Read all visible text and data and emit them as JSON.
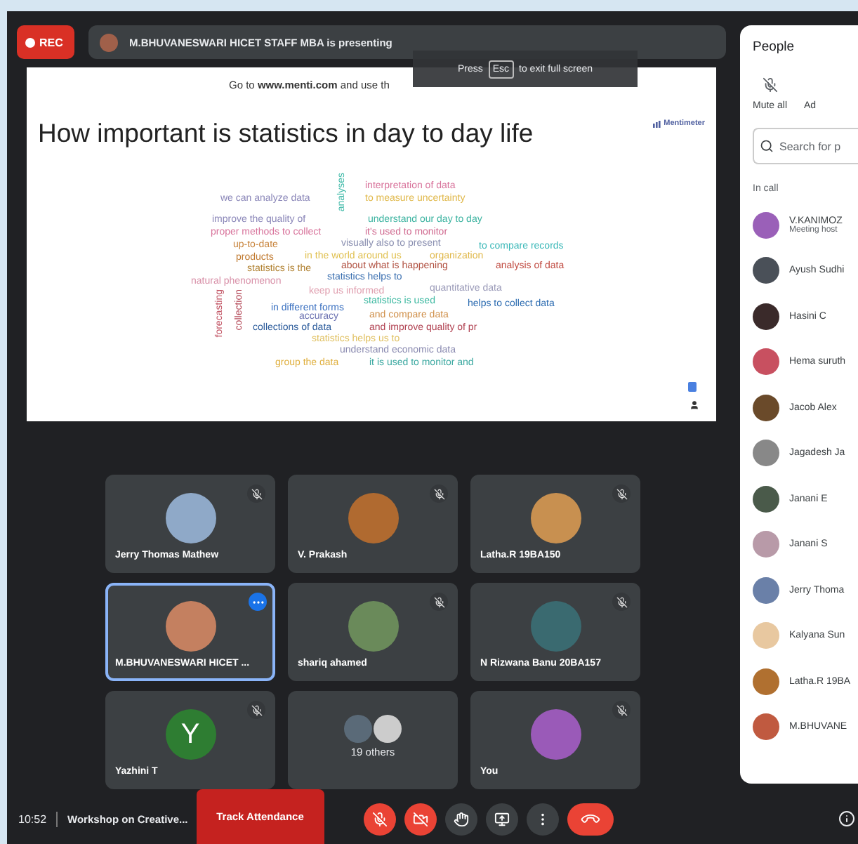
{
  "top_bar": {
    "rec_label": "REC",
    "presenting": "M.BHUVANESWARI HICET STAFF MBA is presenting"
  },
  "fullscreen_hint": {
    "before": "Press",
    "key": "Esc",
    "after": "to exit full screen"
  },
  "slide": {
    "instruction": "Go to **www.menti.com** and use th",
    "title": "How important is statistics in day to day life",
    "brand": "Mentimeter",
    "word_cloud": [
      {
        "text": "we can analyze data",
        "color": "#8a86b8"
      },
      {
        "text": "analyses",
        "color": "#3bb8a6"
      },
      {
        "text": "interpretation of data",
        "color": "#d8739b"
      },
      {
        "text": "to measure uncertainty",
        "color": "#e0b84a"
      },
      {
        "text": "improve the quality of",
        "color": "#8a86b8"
      },
      {
        "text": "understand our day to day",
        "color": "#3bb3a0"
      },
      {
        "text": "proper methods to collect",
        "color": "#d8739b"
      },
      {
        "text": "it's used to monitor",
        "color": "#d06a90"
      },
      {
        "text": "up-to-date",
        "color": "#c8843c"
      },
      {
        "text": "visually also to present",
        "color": "#8a8fb0"
      },
      {
        "text": "to compare records",
        "color": "#3bb8b8"
      },
      {
        "text": "products",
        "color": "#c07a30"
      },
      {
        "text": "in the world around us",
        "color": "#e0c050"
      },
      {
        "text": "organization",
        "color": "#e0b84a"
      },
      {
        "text": "statistics is the",
        "color": "#b08030"
      },
      {
        "text": "about what is happening",
        "color": "#b05040"
      },
      {
        "text": "analysis of data",
        "color": "#c04a40"
      },
      {
        "text": "natural phenomenon",
        "color": "#d890a8"
      },
      {
        "text": "statistics helps to",
        "color": "#3a6fb0"
      },
      {
        "text": "keep us informed",
        "color": "#e0a0b0"
      },
      {
        "text": "quantitative data",
        "color": "#9a9ab8"
      },
      {
        "text": "forecasting",
        "color": "#c05060"
      },
      {
        "text": "collection",
        "color": "#b04050"
      },
      {
        "text": "in different forms",
        "color": "#3a70c0"
      },
      {
        "text": "statistics is used",
        "color": "#3bb8a0"
      },
      {
        "text": "helps to collect data",
        "color": "#2a6ab0"
      },
      {
        "text": "accuracy",
        "color": "#6a70b0"
      },
      {
        "text": "and compare data",
        "color": "#d0904a"
      },
      {
        "text": "collections of data",
        "color": "#2a5a9a"
      },
      {
        "text": "and improve quality of pr",
        "color": "#b04050"
      },
      {
        "text": "statistics helps us to",
        "color": "#e0c060"
      },
      {
        "text": "understand economic data",
        "color": "#8a8ab0"
      },
      {
        "text": "group the data",
        "color": "#e0b040"
      },
      {
        "text": "it is used to monitor and",
        "color": "#3aa8a0"
      }
    ]
  },
  "tiles": [
    {
      "name": "Jerry Thomas Mathew",
      "muted": true,
      "selected": false,
      "avatar": {
        "kind": "photo"
      }
    },
    {
      "name": "V. Prakash",
      "muted": true,
      "selected": false,
      "avatar": {
        "kind": "photo"
      }
    },
    {
      "name": "Latha.R 19BA150",
      "muted": true,
      "selected": false,
      "avatar": {
        "kind": "photo"
      }
    },
    {
      "name": "M.BHUVANESWARI HICET ...",
      "muted": false,
      "selected": true,
      "avatar": {
        "kind": "photo"
      }
    },
    {
      "name": "shariq ahamed",
      "muted": true,
      "selected": false,
      "avatar": {
        "kind": "photo"
      }
    },
    {
      "name": "N Rizwana Banu 20BA157",
      "muted": true,
      "selected": false,
      "avatar": {
        "kind": "photo"
      }
    },
    {
      "name": "Yazhini T",
      "muted": true,
      "selected": false,
      "avatar": {
        "kind": "letter",
        "letter": "Y",
        "color": "#2e7d32"
      }
    },
    {
      "name": "19 others",
      "muted": false,
      "selected": false,
      "avatar": {
        "kind": "group"
      }
    },
    {
      "name": "You",
      "muted": true,
      "selected": false,
      "avatar": {
        "kind": "photo"
      }
    }
  ],
  "people_panel": {
    "title": "People",
    "actions": [
      "Mute all",
      "Ad"
    ],
    "search": {
      "placeholder": "Search for p"
    },
    "section": "In call",
    "people": [
      {
        "name": "V.KANIMOZ",
        "subtitle": "Meeting host"
      },
      {
        "name": "Ayush Sudhi"
      },
      {
        "name": "Hasini C"
      },
      {
        "name": "Hema suruth"
      },
      {
        "name": "Jacob Alex"
      },
      {
        "name": "Jagadesh Ja"
      },
      {
        "name": "Janani E"
      },
      {
        "name": "Janani S"
      },
      {
        "name": "Jerry Thoma"
      },
      {
        "name": "Kalyana Sun"
      },
      {
        "name": "Latha.R 19BA"
      },
      {
        "name": "M.BHUVANE"
      }
    ]
  },
  "bottom_bar": {
    "time": "10:52",
    "meeting_title": "Workshop on Creative...",
    "track_button": "Track Attendance",
    "controls": [
      {
        "kind": "mic",
        "off": true
      },
      {
        "kind": "camera",
        "off": true
      },
      {
        "kind": "hand",
        "off": false
      },
      {
        "kind": "present",
        "off": false
      },
      {
        "kind": "more",
        "off": false
      },
      {
        "kind": "end",
        "off": true
      }
    ]
  }
}
